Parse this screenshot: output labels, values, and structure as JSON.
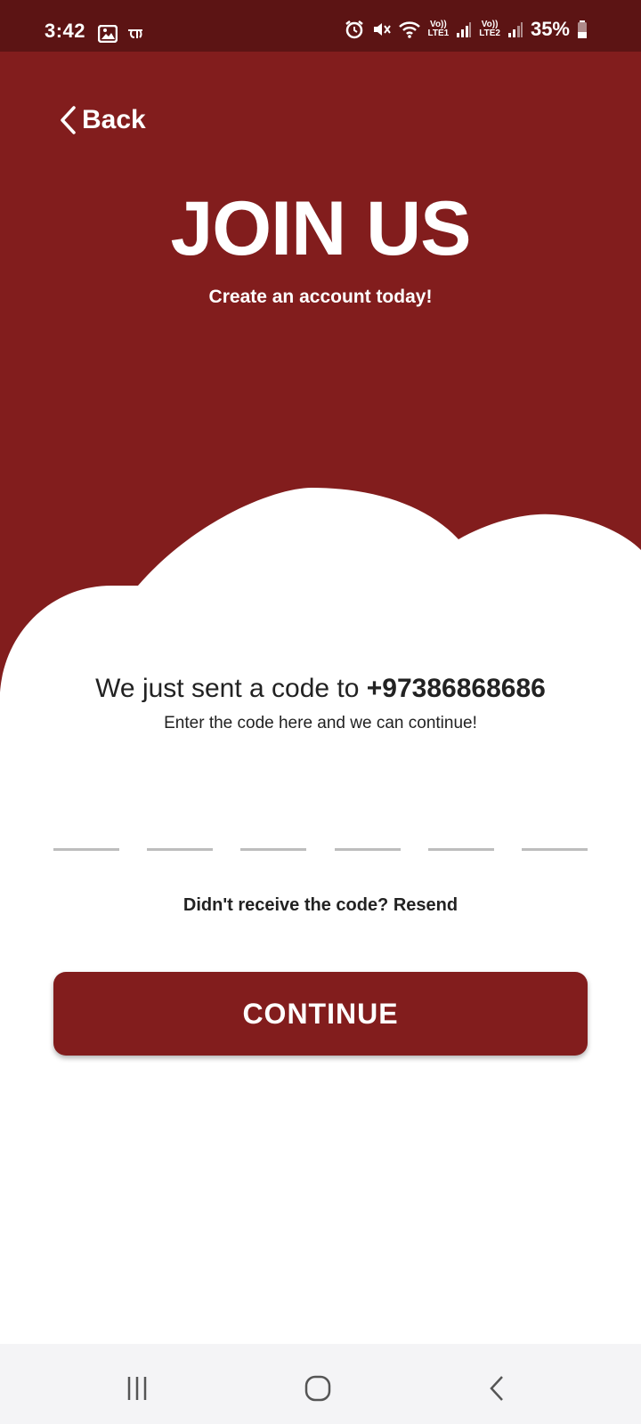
{
  "status_bar": {
    "time": "3:42",
    "battery": "35%",
    "lte1_top": "Vo))",
    "lte1_bottom": "LTE1",
    "lte2_top": "Vo))",
    "lte2_bottom": "LTE2",
    "icons": [
      "gallery-icon",
      "app-notification-icon",
      "alarm-icon",
      "mute-icon",
      "wifi-icon",
      "signal-icon",
      "battery-icon"
    ]
  },
  "header": {
    "back_label": "Back",
    "title": "JOIN US",
    "subtitle": "Create an account today!"
  },
  "verification": {
    "heading_prefix": "We just sent a code to ",
    "phone_number": "+97386868686",
    "subheading": "Enter the code here and we can continue!",
    "code_digits": [
      "",
      "",
      "",
      "",
      "",
      ""
    ]
  },
  "resend": {
    "prompt": "Didn't receive the code? ",
    "link_label": "Resend"
  },
  "continue_button": {
    "label": "CONTINUE"
  },
  "colors": {
    "brand": "#821d1d",
    "status_bar": "#5c1414",
    "otp_underline": "#bdbdbd"
  },
  "nav_bar": {
    "icons": [
      "recent-apps-icon",
      "home-icon",
      "back-icon"
    ]
  }
}
